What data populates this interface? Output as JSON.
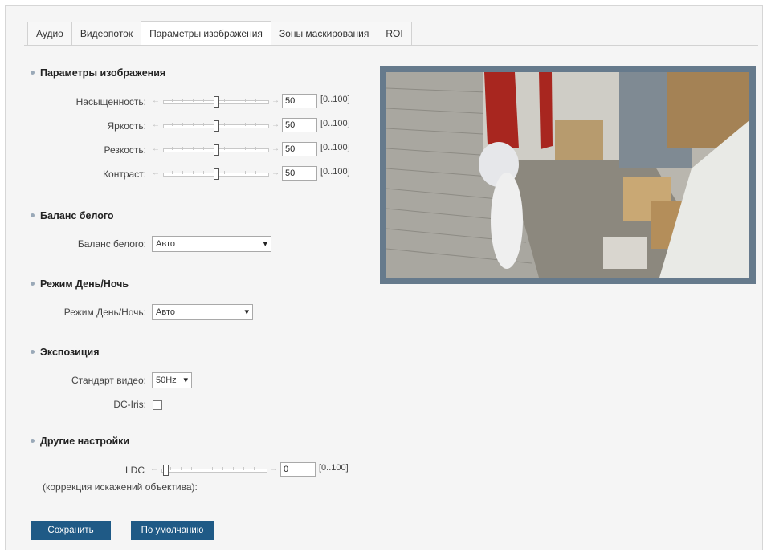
{
  "tabs": [
    {
      "label": "Аудио",
      "active": false
    },
    {
      "label": "Видеопоток",
      "active": false
    },
    {
      "label": "Параметры изображения",
      "active": true
    },
    {
      "label": "Зоны маскирования",
      "active": false
    },
    {
      "label": "ROI",
      "active": false
    }
  ],
  "image_params": {
    "title": "Параметры изображения",
    "saturation": {
      "label": "Насыщенность:",
      "value": "50",
      "range": "[0..100]"
    },
    "brightness": {
      "label": "Яркость:",
      "value": "50",
      "range": "[0..100]"
    },
    "sharpness": {
      "label": "Резкость:",
      "value": "50",
      "range": "[0..100]"
    },
    "contrast": {
      "label": "Контраст:",
      "value": "50",
      "range": "[0..100]"
    }
  },
  "white_balance": {
    "title": "Баланс белого",
    "label": "Баланс белого:",
    "value": "Авто"
  },
  "day_night": {
    "title": "Режим День/Ночь",
    "label": "Режим День/Ночь:",
    "value": "Авто"
  },
  "exposure": {
    "title": "Экспозиция",
    "video_standard_label": "Стандарт видео:",
    "video_standard_value": "50Hz",
    "dc_iris_label": "DC-Iris:",
    "dc_iris_checked": false
  },
  "other": {
    "title": "Другие настройки",
    "ldc_label": "LDC",
    "ldc_sublabel": "(коррекция искажений объектива):",
    "ldc_value": "0",
    "ldc_range": "[0..100]"
  },
  "buttons": {
    "save": "Сохранить",
    "default": "По умолчанию"
  },
  "icons": {
    "arrow_left": "←",
    "arrow_right": "→",
    "chevron_down": "▾"
  }
}
